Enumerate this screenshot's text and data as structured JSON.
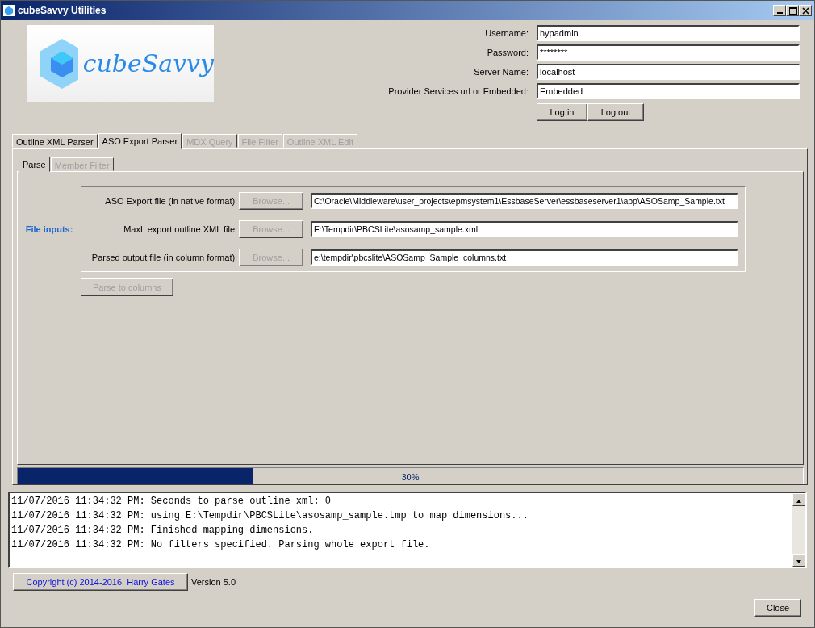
{
  "window": {
    "title": "cubeSavvy Utilities"
  },
  "logo": {
    "text": "cubeSavvy"
  },
  "login": {
    "fields": [
      {
        "label": "Username:",
        "value": "hypadmin"
      },
      {
        "label": "Password:",
        "value": "********"
      },
      {
        "label": "Server Name:",
        "value": "localhost"
      },
      {
        "label": "Provider Services url or Embedded:",
        "value": "Embedded"
      }
    ],
    "buttons": [
      "Log in",
      "Log out"
    ]
  },
  "tabs": [
    {
      "label": "Outline XML Parser",
      "selected": false,
      "disabled": false
    },
    {
      "label": "ASO Export Parser",
      "selected": true,
      "disabled": false
    },
    {
      "label": "MDX Query",
      "selected": false,
      "disabled": true
    },
    {
      "label": "File Filter",
      "selected": false,
      "disabled": true
    },
    {
      "label": "Outline XML Edit",
      "selected": false,
      "disabled": true
    }
  ],
  "subtabs": [
    {
      "label": "Parse",
      "selected": true,
      "disabled": false
    },
    {
      "label": "Member Filter",
      "selected": false,
      "disabled": true
    }
  ],
  "file_inputs": {
    "title": "File inputs:",
    "rows": [
      {
        "label": "ASO Export file (in native format):",
        "button": "Browse...",
        "button_disabled": true,
        "value": "C:\\Oracle\\Middleware\\user_projects\\epmsystem1\\EssbaseServer\\essbaseserver1\\app\\ASOSamp_Sample.txt"
      },
      {
        "label": "MaxL export outline XML file:",
        "button": "Browse...",
        "button_disabled": true,
        "value": "E:\\Tempdir\\PBCSLite\\asosamp_sample.xml"
      },
      {
        "label": "Parsed output file (in column format):",
        "button": "Browse...",
        "button_disabled": true,
        "value": "e:\\tempdir\\pbcslite\\ASOSamp_Sample_columns.txt"
      }
    ]
  },
  "parse_button": {
    "label": "Parse to columns",
    "disabled": true
  },
  "progress": {
    "level": 0.3,
    "reading": "30%"
  },
  "log": [
    "11/07/2016 11:34:32 PM: Seconds to parse outline xml: 0",
    "11/07/2016 11:34:32 PM: using E:\\Tempdir\\PBCSLite\\asosamp_sample.tmp to map dimensions...",
    "11/07/2016 11:34:32 PM: Finished mapping dimensions.",
    "11/07/2016 11:34:32 PM: No filters specified. Parsing whole export file."
  ],
  "footer": {
    "copyright": "Copyright (c) 2014-2016. Harry Gates",
    "version": "Version 5.0",
    "close": "Close"
  }
}
